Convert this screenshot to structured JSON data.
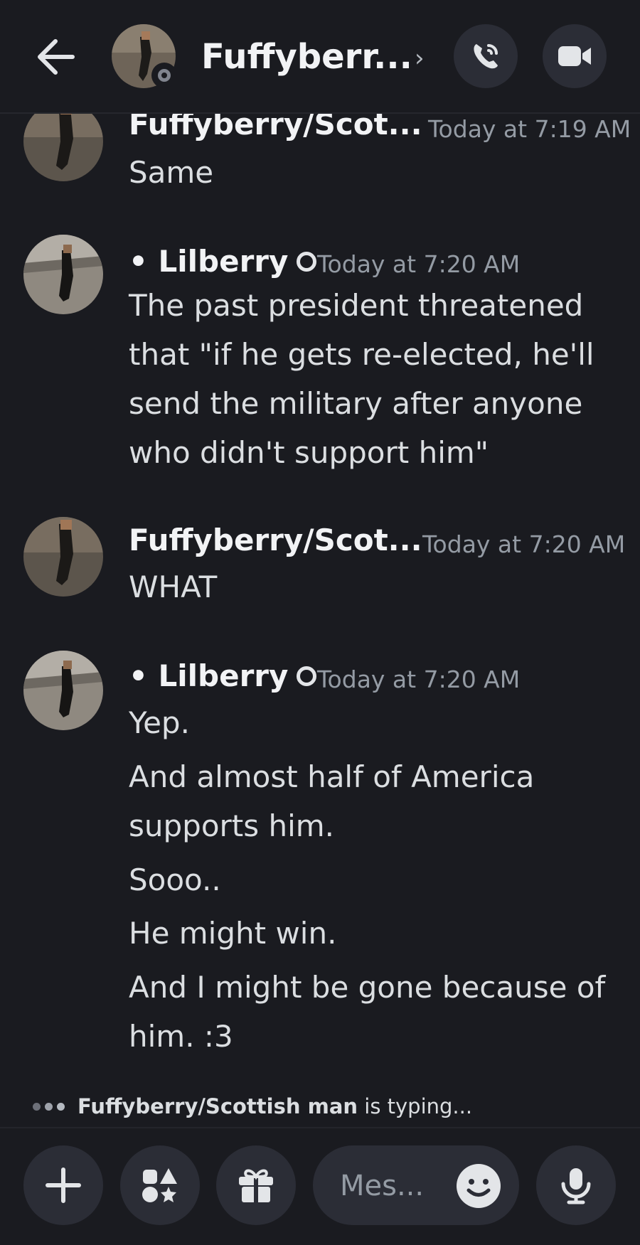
{
  "header": {
    "title": "Fuffyberr...",
    "chevron": "›",
    "back_icon": "arrow-left-icon",
    "call_icon": "phone-call-icon",
    "video_icon": "video-camera-icon"
  },
  "messages": [
    {
      "author": "Fuffyberry/Scot...",
      "time": "Today at 7:19 AM",
      "lines": [
        "Same"
      ]
    },
    {
      "author": "• Lilberry",
      "time": "Today at 7:20 AM",
      "lines": [
        "The past president threatened",
        "that \"if he gets re-elected, he'll",
        "send the military after anyone",
        "who didn't support him\""
      ]
    },
    {
      "author": "Fuffyberry/Scot...",
      "time": "Today at 7:20 AM",
      "lines": [
        "WHAT"
      ]
    },
    {
      "author": "• Lilberry",
      "time": "Today at 7:20 AM",
      "lines": [
        "Yep.",
        "And almost half of America",
        "supports him.",
        "Sooo..",
        "He might win.",
        "And I might be gone because of",
        "him. :3"
      ]
    }
  ],
  "typing": {
    "name": "Fuffyberry/Scottish man",
    "suffix": " is typing..."
  },
  "composer": {
    "placeholder": "Mes...",
    "icons": [
      "plus-icon",
      "apps-icon",
      "gift-icon",
      "emoji-icon",
      "microphone-icon"
    ]
  },
  "colors": {
    "background": "#1a1b20",
    "button_bg": "#2b2d36",
    "timestamp": "#949ba4"
  }
}
